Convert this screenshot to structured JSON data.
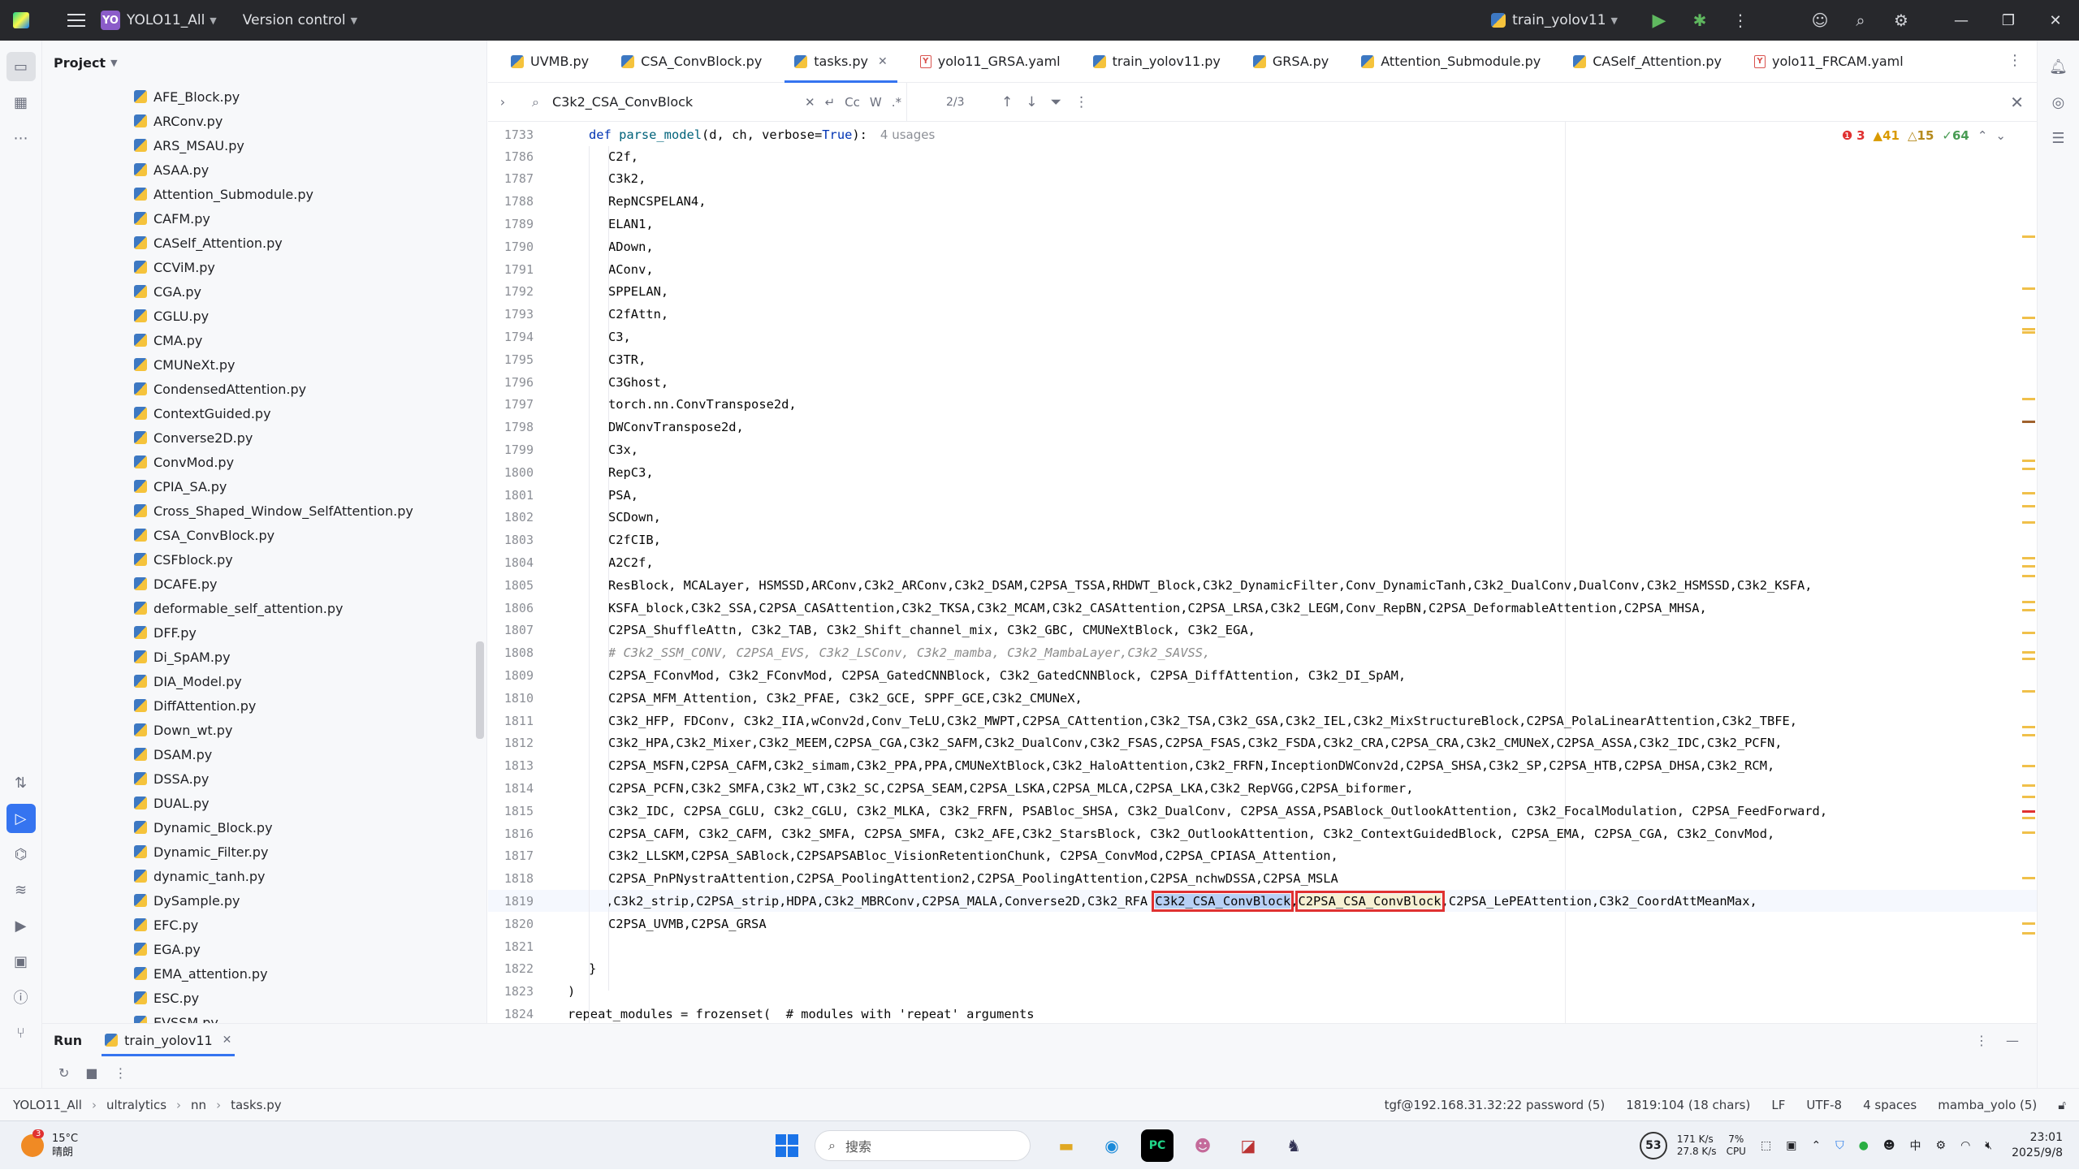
{
  "titlebar": {
    "project_badge": "YO",
    "project_name": "YOLO11_All",
    "vcs": "Version control",
    "run_config": "train_yolov11"
  },
  "project_panel": {
    "title": "Project",
    "files": [
      "AFE_Block.py",
      "ARConv.py",
      "ARS_MSAU.py",
      "ASAA.py",
      "Attention_Submodule.py",
      "CAFM.py",
      "CASelf_Attention.py",
      "CCViM.py",
      "CGA.py",
      "CGLU.py",
      "CMA.py",
      "CMUNeXt.py",
      "CondensedAttention.py",
      "ContextGuided.py",
      "Converse2D.py",
      "ConvMod.py",
      "CPIA_SA.py",
      "Cross_Shaped_Window_SelfAttention.py",
      "CSA_ConvBlock.py",
      "CSFblock.py",
      "DCAFE.py",
      "deformable_self_attention.py",
      "DFF.py",
      "Di_SpAM.py",
      "DIA_Model.py",
      "DiffAttention.py",
      "Down_wt.py",
      "DSAM.py",
      "DSSA.py",
      "DUAL.py",
      "Dynamic_Block.py",
      "Dynamic_Filter.py",
      "dynamic_tanh.py",
      "DySample.py",
      "EFC.py",
      "EGA.py",
      "EMA_attention.py",
      "ESC.py",
      "EVSSM.py"
    ]
  },
  "tabs": [
    {
      "label": "UVMB.py",
      "type": "py"
    },
    {
      "label": "CSA_ConvBlock.py",
      "type": "py"
    },
    {
      "label": "tasks.py",
      "type": "py",
      "active": true
    },
    {
      "label": "yolo11_GRSA.yaml",
      "type": "yaml"
    },
    {
      "label": "train_yolov11.py",
      "type": "py"
    },
    {
      "label": "GRSA.py",
      "type": "py"
    },
    {
      "label": "Attention_Submodule.py",
      "type": "py"
    },
    {
      "label": "CASelf_Attention.py",
      "type": "py"
    },
    {
      "label": "yolo11_FRCAM.yaml",
      "type": "yaml"
    }
  ],
  "find": {
    "query": "C3k2_CSA_ConvBlock",
    "case": "Cc",
    "word": "W",
    "regex": ".*",
    "count": "2/3"
  },
  "sticky": {
    "ln": "1733",
    "usages": "4 usages"
  },
  "inspections": {
    "errors": "3",
    "warnings": "41",
    "weak": "15",
    "ok": "64"
  },
  "code_lines": [
    {
      "ln": "1786",
      "text": "C2f,"
    },
    {
      "ln": "1787",
      "text": "C3k2,"
    },
    {
      "ln": "1788",
      "text": "RepNCSPELAN4,"
    },
    {
      "ln": "1789",
      "text": "ELAN1,"
    },
    {
      "ln": "1790",
      "text": "ADown,"
    },
    {
      "ln": "1791",
      "text": "AConv,"
    },
    {
      "ln": "1792",
      "text": "SPPELAN,"
    },
    {
      "ln": "1793",
      "text": "C2fAttn,"
    },
    {
      "ln": "1794",
      "text": "C3,"
    },
    {
      "ln": "1795",
      "text": "C3TR,"
    },
    {
      "ln": "1796",
      "text": "C3Ghost,"
    },
    {
      "ln": "1797",
      "text": "torch.nn.ConvTranspose2d,"
    },
    {
      "ln": "1798",
      "text": "DWConvTranspose2d,"
    },
    {
      "ln": "1799",
      "text": "C3x,"
    },
    {
      "ln": "1800",
      "text": "RepC3,"
    },
    {
      "ln": "1801",
      "text": "PSA,"
    },
    {
      "ln": "1802",
      "text": "SCDown,"
    },
    {
      "ln": "1803",
      "text": "C2fCIB,"
    },
    {
      "ln": "1804",
      "text": "A2C2f,"
    },
    {
      "ln": "1805",
      "text": "ResBlock, MCALayer, HSMSSD,ARConv,C3k2_ARConv,C3k2_DSAM,C2PSA_TSSA,RHDWT_Block,C3k2_DynamicFilter,Conv_DynamicTanh,C3k2_DualConv,DualConv,C3k2_HSMSSD,C3k2_KSFA,"
    },
    {
      "ln": "1806",
      "text": "KSFA_block,C3k2_SSA,C2PSA_CASAttention,C3k2_TKSA,C3k2_MCAM,C3k2_CASAttention,C2PSA_LRSA,C3k2_LEGM,Conv_RepBN,C2PSA_DeformableAttention,C2PSA_MHSA,"
    },
    {
      "ln": "1807",
      "text": "C2PSA_ShuffleAttn, C3k2_TAB, C3k2_Shift_channel_mix, C3k2_GBC, CMUNeXtBlock, C3k2_EGA,"
    },
    {
      "ln": "1808",
      "text": "# C3k2_SSM_CONV, C2PSA_EVS, C3k2_LSConv, C3k2_mamba, C3k2_MambaLayer,C3k2_SAVSS,",
      "comment": true
    },
    {
      "ln": "1809",
      "text": "C2PSA_FConvMod, C3k2_FConvMod, C2PSA_GatedCNNBlock, C3k2_GatedCNNBlock, C2PSA_DiffAttention, C3k2_DI_SpAM,"
    },
    {
      "ln": "1810",
      "text": "C2PSA_MFM_Attention, C3k2_PFAE, C3k2_GCE, SPPF_GCE,C3k2_CMUNeX,"
    },
    {
      "ln": "1811",
      "text": "C3k2_HFP, FDConv, C3k2_IIA,wConv2d,Conv_TeLU,C3k2_MWPT,C2PSA_CAttention,C3k2_TSA,C3k2_GSA,C3k2_IEL,C3k2_MixStructureBlock,C2PSA_PolaLinearAttention,C3k2_TBFE,"
    },
    {
      "ln": "1812",
      "text": "C3k2_HPA,C3k2_Mixer,C3k2_MEEM,C2PSA_CGA,C3k2_SAFM,C3k2_DualConv,C3k2_FSAS,C2PSA_FSAS,C3k2_FSDA,C3k2_CRA,C2PSA_CRA,C3k2_CMUNeX,C2PSA_ASSA,C3k2_IDC,C3k2_PCFN,"
    },
    {
      "ln": "1813",
      "text": "C2PSA_MSFN,C2PSA_CAFM,C3k2_simam,C3k2_PPA,PPA,CMUNeXtBlock,C3k2_HaloAttention,C3k2_FRFN,InceptionDWConv2d,C2PSA_SHSA,C3k2_SP,C2PSA_HTB,C2PSA_DHSA,C3k2_RCM,"
    },
    {
      "ln": "1814",
      "text": "C2PSA_PCFN,C3k2_SMFA,C3k2_WT,C3k2_SC,C2PSA_SEAM,C2PSA_LSKA,C2PSA_MLCA,C2PSA_LKA,C3k2_RepVGG,C2PSA_biformer,"
    },
    {
      "ln": "1815",
      "text": "C3k2_IDC, C2PSA_CGLU, C3k2_CGLU, C3k2_MLKA, C3k2_FRFN, PSABloc_SHSA, C3k2_DualConv, C2PSA_ASSA,PSABlock_OutlookAttention, C3k2_FocalModulation, C2PSA_FeedForward,"
    },
    {
      "ln": "1816",
      "text": "C2PSA_CAFM, C3k2_CAFM, C3k2_SMFA, C2PSA_SMFA, C3k2_AFE,C3k2_StarsBlock, C3k2_OutlookAttention, C3k2_ContextGuidedBlock, C2PSA_EMA, C2PSA_CGA, C3k2_ConvMod,"
    },
    {
      "ln": "1817",
      "text": "C3k2_LLSKM,C2PSA_SABlock,C2PSAPSABloc_VisionRetentionChunk, C2PSA_ConvMod,C2PSA_CPIASA_Attention,"
    },
    {
      "ln": "1818",
      "text": "C2PSA_PnPNystraAttention,C2PSA_PoolingAttention2,C2PSA_PoolingAttention,C2PSA_nchwDSSA,C2PSA_MSLA"
    },
    {
      "ln": "1819",
      "pre": ",C3k2_strip,C2PSA_strip,HDPA,C3k2_MBRConv,C2PSA_MALA,Converse2D,C3k2_RFA ",
      "hl1": "C3k2_CSA_ConvBlock",
      "mid": ",",
      "hl2": "C2PSA_CSA_ConvBlock",
      "post": ",C2PSA_LePEAttention,C3k2_CoordAttMeanMax,"
    },
    {
      "ln": "1820",
      "text": "C2PSA_UVMB,C2PSA_GRSA"
    },
    {
      "ln": "1821",
      "text": ""
    },
    {
      "ln": "1822",
      "text": "}"
    },
    {
      "ln": "1823",
      "text": ")"
    },
    {
      "ln": "1824",
      "text": "repeat_modules = frozenset(  # modules with 'repeat' arguments"
    }
  ],
  "run": {
    "label": "Run",
    "tab": "train_yolov11"
  },
  "status": {
    "crumbs": [
      "YOLO11_All",
      "ultralytics",
      "nn",
      "tasks.py"
    ],
    "remote": "tgf@192.168.31.32:22 password (5)",
    "position": "1819:104 (18 chars)",
    "eol": "LF",
    "encoding": "UTF-8",
    "indent": "4 spaces",
    "interpreter": "mamba_yolo (5)"
  },
  "taskbar": {
    "weather_temp": "15°C",
    "weather_desc": "晴朗",
    "weather_badge": "3",
    "search": "搜索",
    "cpu_circle": "53",
    "net_up": "171 K/s",
    "net_down": "27.8 K/s",
    "cpu": "7%",
    "cpu_label": "CPU",
    "ime": "中",
    "time": "23:01",
    "date": "2025/9/8"
  }
}
